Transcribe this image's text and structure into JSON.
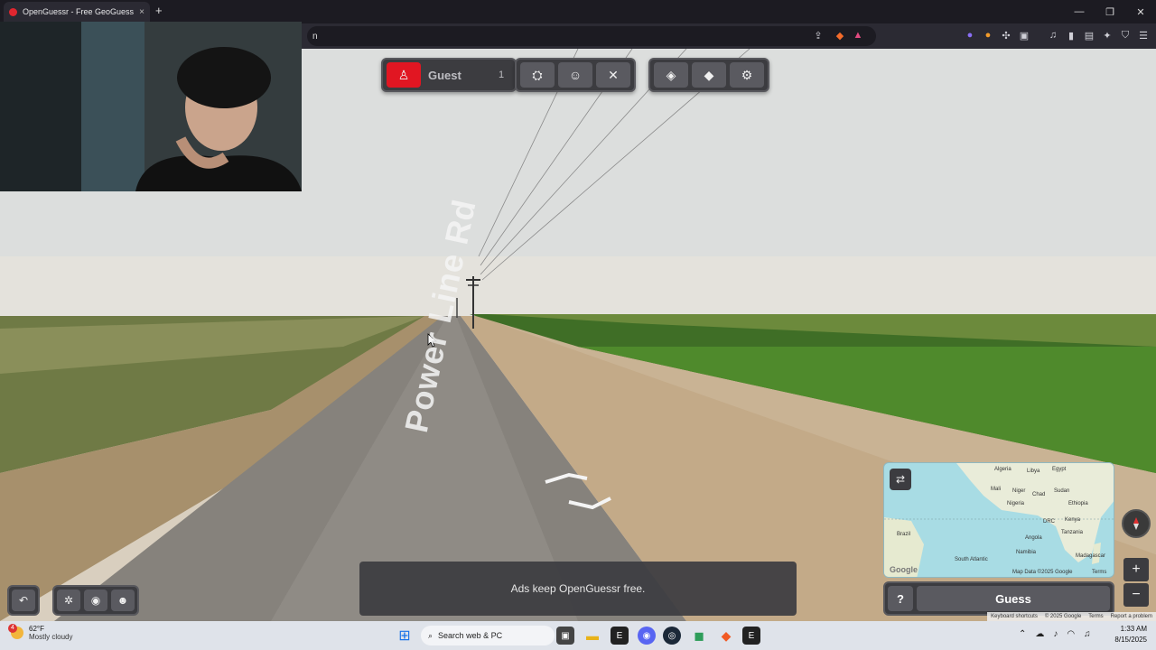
{
  "browser": {
    "tab_title": "OpenGuessr - Free GeoGuessr A",
    "tab_close": "×",
    "new_tab": "+",
    "url_fragment": "n",
    "window_controls": [
      "—",
      "❐",
      "✕"
    ]
  },
  "toolbar": {
    "player_label": "Guest",
    "player_count": "1"
  },
  "scene": {
    "street_name": "Power Line Rd",
    "ads_text": "Ads keep OpenGuessr free."
  },
  "minimap": {
    "labels": [
      "Algeria",
      "Libya",
      "Egypt",
      "Mali",
      "Niger",
      "Chad",
      "Sudan",
      "Ethiopia",
      "Nigeria",
      "DRC",
      "Kenya",
      "Tanzania",
      "Angola",
      "Namibia",
      "Madagascar",
      "Brazil",
      "South Atlantic"
    ],
    "google": "Google",
    "map_data": "Map Data ©2025 Google",
    "terms": "Terms"
  },
  "guess": {
    "help_label": "?",
    "guess_label": "Guess"
  },
  "zoom": {
    "in": "+",
    "out": "−"
  },
  "google_footer": {
    "shortcuts": "Keyboard shortcuts",
    "copyright": "© 2025 Google",
    "terms": "Terms",
    "report": "Report a problem"
  },
  "taskbar": {
    "weather_badge": "4",
    "temperature": "62°F",
    "condition": "Mostly cloudy",
    "search_placeholder": "Search web & PC",
    "time": "1:33 AM",
    "date": "8/15/2025"
  },
  "colors": {
    "accent_red": "#e11622",
    "panel": "#3c3c40"
  }
}
